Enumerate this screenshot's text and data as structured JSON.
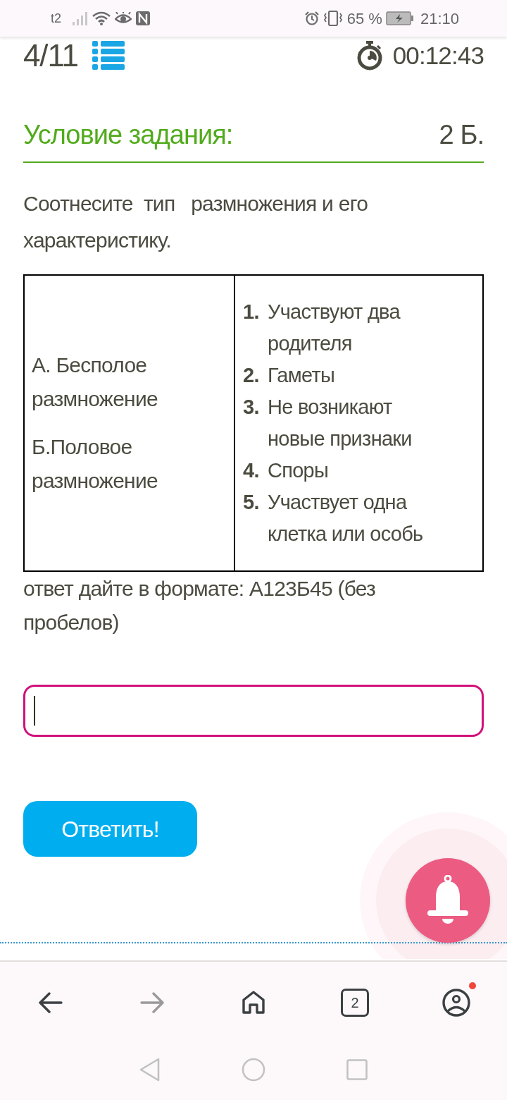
{
  "status_bar": {
    "carrier": "t2",
    "battery": "65 %",
    "time": "21:10"
  },
  "header": {
    "counter": "4/11",
    "timer": "00:12:43"
  },
  "task": {
    "title": "Условие задания:",
    "points": "2 Б.",
    "question": "Соотнесите  тип   размножения и его характеристику.",
    "table": {
      "left": [
        "А. Бесполое размножение",
        "Б.Половое размножение"
      ],
      "right": [
        {
          "number": "1.",
          "text": "Участвуют два родителя"
        },
        {
          "number": "2.",
          "text": "Гаметы"
        },
        {
          "number": "3.",
          "text": "Не возникают новые признаки"
        },
        {
          "number": "4.",
          "text": "Споры"
        },
        {
          "number": "5.",
          "text": "Участвует одна клетка или особь"
        }
      ]
    },
    "hint": "ответ дайте в формате: А123Б45 (без пробелов)",
    "answer_field": {
      "focused": true
    },
    "submit_button": "Ответить!"
  },
  "browser_bar": {
    "items": [
      {
        "kind": "back",
        "disabled": false
      },
      {
        "kind": "forward",
        "disabled": true
      },
      {
        "kind": "home"
      },
      {
        "kind": "tabs",
        "count": "2"
      },
      {
        "kind": "profile",
        "badge": true
      }
    ]
  }
}
